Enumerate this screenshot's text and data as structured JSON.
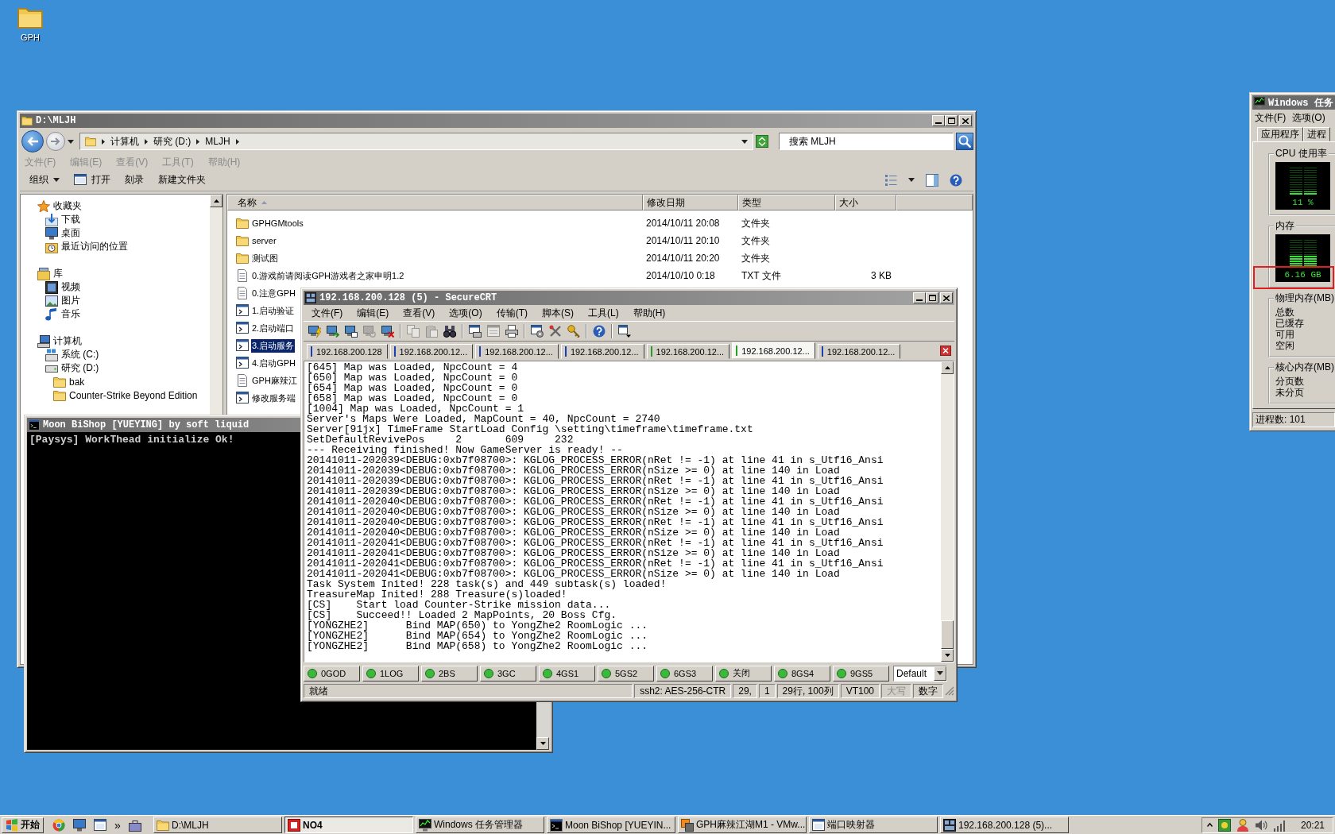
{
  "desktop": {
    "icons": [
      {
        "label": "GPH"
      }
    ]
  },
  "explorer": {
    "title": "D:\\MLJH",
    "breadcrumb": [
      "计算机",
      "研究 (D:)",
      "MLJH"
    ],
    "search": {
      "placeholder": "搜索 MLJH"
    },
    "menu": [
      "文件(F)",
      "编辑(E)",
      "查看(V)",
      "工具(T)",
      "帮助(H)"
    ],
    "toolbar": [
      {
        "label": "组织",
        "kind": "menu"
      },
      {
        "label": "打开",
        "kind": "open"
      },
      {
        "label": "刻录",
        "kind": "plain"
      },
      {
        "label": "新建文件夹",
        "kind": "plain"
      }
    ],
    "nav": [
      {
        "label": "收藏夹",
        "kind": "favorites",
        "children": [
          {
            "label": "下载",
            "kind": "download"
          },
          {
            "label": "桌面",
            "kind": "desktop"
          },
          {
            "label": "最近访问的位置",
            "kind": "recent"
          }
        ]
      },
      {
        "label": "库",
        "kind": "library",
        "children": [
          {
            "label": "视频",
            "kind": "video"
          },
          {
            "label": "图片",
            "kind": "picture"
          },
          {
            "label": "音乐",
            "kind": "music"
          }
        ]
      },
      {
        "label": "计算机",
        "kind": "computer",
        "children": [
          {
            "label": "系统 (C:)",
            "kind": "system-drive"
          },
          {
            "label": "研究 (D:)",
            "kind": "drive",
            "children": [
              {
                "label": "bak",
                "kind": "folder"
              },
              {
                "label": "Counter-Strike Beyond Edition",
                "kind": "folder"
              }
            ]
          }
        ]
      }
    ],
    "columns": [
      {
        "label": "名称",
        "sorted": true
      },
      {
        "label": "修改日期",
        "sorted": false
      },
      {
        "label": "类型",
        "sorted": false
      },
      {
        "label": "大小",
        "sorted": false
      }
    ],
    "rows": [
      {
        "name": "GPHGMtools",
        "kind": "folder",
        "date": "2014/10/11 20:08",
        "type": "文件夹",
        "selected": false
      },
      {
        "name": "server",
        "kind": "folder",
        "date": "2014/10/11 20:10",
        "type": "文件夹",
        "selected": false
      },
      {
        "name": "测试图",
        "kind": "folder",
        "date": "2014/10/11 20:20",
        "type": "文件夹",
        "selected": false
      },
      {
        "name": "0.游戏前请阅读GPH游戏者之家申明1.2",
        "kind": "document",
        "date": "2014/10/10 0:18",
        "type": "TXT 文件",
        "size": "3 KB",
        "selected": false
      },
      {
        "name": "0.注意GPH",
        "kind": "document",
        "selected": false
      },
      {
        "name": "1.启动验证",
        "kind": "program",
        "selected": false
      },
      {
        "name": "2.启动端口",
        "kind": "program",
        "selected": false
      },
      {
        "name": "3.启动服务",
        "kind": "program",
        "selected": true
      },
      {
        "name": "4.启动GPH",
        "kind": "program",
        "selected": false
      },
      {
        "name": "GPH麻辣江",
        "kind": "document",
        "selected": false
      },
      {
        "name": "修改服务端",
        "kind": "program",
        "selected": false
      }
    ]
  },
  "console": {
    "title": "Moon BiShop [YUEYING] by soft liquid",
    "lines": [
      "[Paysys] WorkThead initialize Ok!"
    ]
  },
  "securecrt": {
    "title": "192.168.200.128 (5) - SecureCRT",
    "menu": [
      "文件(F)",
      "编辑(E)",
      "查看(V)",
      "选项(O)",
      "传输(T)",
      "脚本(S)",
      "工具(L)",
      "帮助(H)"
    ],
    "toolbar": [
      {
        "items": [
          {
            "kind": "monitor-bolt",
            "disabled": false
          },
          {
            "kind": "monitor-arrow",
            "disabled": false
          },
          {
            "kind": "monitor-tab",
            "disabled": false
          },
          {
            "kind": "monitor-cycle",
            "disabled": true
          },
          {
            "kind": "monitor-cross",
            "disabled": false
          }
        ]
      },
      {
        "items": [
          {
            "kind": "copy",
            "disabled": true
          },
          {
            "kind": "paste",
            "disabled": true
          },
          {
            "kind": "binoculars",
            "disabled": false
          }
        ]
      },
      {
        "items": [
          {
            "kind": "window-printer",
            "disabled": false
          },
          {
            "kind": "window-lines",
            "disabled": true
          },
          {
            "kind": "printer",
            "disabled": false
          }
        ]
      },
      {
        "items": [
          {
            "kind": "window-gear",
            "disabled": false
          },
          {
            "kind": "tools",
            "disabled": false
          },
          {
            "kind": "key",
            "disabled": false
          }
        ]
      },
      {
        "items": [
          {
            "kind": "help",
            "disabled": false
          }
        ]
      },
      {
        "items": [
          {
            "kind": "window-caret",
            "disabled": false
          }
        ]
      }
    ],
    "tabs": [
      {
        "label": "192.168.200.128",
        "selected": false,
        "color": "#1c3fb0"
      },
      {
        "label": "192.168.200.12...",
        "selected": false,
        "color": "#1c3fb0"
      },
      {
        "label": "192.168.200.12...",
        "selected": false,
        "color": "#1c3fb0"
      },
      {
        "label": "192.168.200.12...",
        "selected": false,
        "color": "#1c3fb0"
      },
      {
        "label": "192.168.200.12...",
        "selected": false,
        "color": "#2a9a2a"
      },
      {
        "label": "192.168.200.12...",
        "selected": true,
        "color": "#2a9a2a"
      },
      {
        "label": "192.168.200.12...",
        "selected": false,
        "color": "#1c3fb0"
      }
    ],
    "lines": [
      "[645] Map was Loaded, NpcCount = 4",
      "[650] Map was Loaded, NpcCount = 0",
      "[654] Map was Loaded, NpcCount = 0",
      "[658] Map was Loaded, NpcCount = 0",
      "[1004] Map was Loaded, NpcCount = 1",
      "Server's Maps Were Loaded, MapCount = 40, NpcCount = 2740",
      "Server[91jx] TimeFrame StartLoad Config \\setting\\timeframe\\timeframe.txt",
      "SetDefaultRevivePos\t2\t609\t232",
      "--- Receiving finished! Now GameServer is ready! --",
      "20141011-202039<DEBUG:0xb7f08700>: KGLOG_PROCESS_ERROR(nRet != -1) at line 41 in s_Utf16_Ansi",
      "20141011-202039<DEBUG:0xb7f08700>: KGLOG_PROCESS_ERROR(nSize >= 0) at line 140 in Load",
      "20141011-202039<DEBUG:0xb7f08700>: KGLOG_PROCESS_ERROR(nRet != -1) at line 41 in s_Utf16_Ansi",
      "20141011-202039<DEBUG:0xb7f08700>: KGLOG_PROCESS_ERROR(nSize >= 0) at line 140 in Load",
      "20141011-202040<DEBUG:0xb7f08700>: KGLOG_PROCESS_ERROR(nRet != -1) at line 41 in s_Utf16_Ansi",
      "20141011-202040<DEBUG:0xb7f08700>: KGLOG_PROCESS_ERROR(nSize >= 0) at line 140 in Load",
      "20141011-202040<DEBUG:0xb7f08700>: KGLOG_PROCESS_ERROR(nRet != -1) at line 41 in s_Utf16_Ansi",
      "20141011-202040<DEBUG:0xb7f08700>: KGLOG_PROCESS_ERROR(nSize >= 0) at line 140 in Load",
      "20141011-202041<DEBUG:0xb7f08700>: KGLOG_PROCESS_ERROR(nRet != -1) at line 41 in s_Utf16_Ansi",
      "20141011-202041<DEBUG:0xb7f08700>: KGLOG_PROCESS_ERROR(nSize >= 0) at line 140 in Load",
      "20141011-202041<DEBUG:0xb7f08700>: KGLOG_PROCESS_ERROR(nRet != -1) at line 41 in s_Utf16_Ansi",
      "20141011-202041<DEBUG:0xb7f08700>: KGLOG_PROCESS_ERROR(nSize >= 0) at line 140 in Load",
      "Task System Inited! 228 task(s) and 449 subtask(s) loaded!",
      "TreasureMap Inited! 288 Treasure(s)loaded!",
      "[CS]\tStart load Counter-Strike mission data...",
      "[CS]\tSucceed!! Loaded 2 MapPoints, 20 Boss Cfg.",
      "[YONGZHE2]\tBind MAP(650) to YongZhe2 RoomLogic ...",
      "[YONGZHE2]\tBind MAP(654) to YongZhe2 RoomLogic ...",
      "[YONGZHE2]\tBind MAP(658) to YongZhe2 RoomLogic ..."
    ],
    "buttons": [
      "0GOD",
      "1LOG",
      "2BS",
      "3GC",
      "4GS1",
      "5GS2",
      "6GS3",
      "关闭",
      "8GS4",
      "9GS5"
    ],
    "session_select": "Default",
    "status": {
      "left": "就绪",
      "cells": [
        {
          "text": "ssh2: AES-256-CTR",
          "disabled": false
        },
        {
          "text": "29,",
          "disabled": false
        },
        {
          "text": "1",
          "disabled": false
        },
        {
          "text": "29行, 100列",
          "disabled": false
        },
        {
          "text": "VT100",
          "disabled": false
        },
        {
          "text": "大写",
          "disabled": true
        },
        {
          "text": "数字",
          "disabled": false
        }
      ]
    }
  },
  "task_manager": {
    "title": "Windows 任务",
    "menu": [
      "文件(F)",
      "选项(O)"
    ],
    "tabs": [
      {
        "label": "应用程序",
        "selected": false
      },
      {
        "label": "进程",
        "selected": false
      }
    ],
    "meters": [
      {
        "label": "CPU 使用率",
        "reading": "11 %",
        "level": 0.11,
        "highlighted": false
      },
      {
        "label": "内存",
        "reading": "6.16 GB",
        "level": 0.38,
        "highlighted": true
      }
    ],
    "groups": [
      {
        "label": "物理内存(MB)",
        "rows": [
          "总数",
          "已缓存",
          "可用",
          "空闲"
        ]
      },
      {
        "label": "核心内存(MB)",
        "rows": [
          "分页数",
          "未分页"
        ]
      }
    ],
    "status": "进程数: 101"
  },
  "taskbar": {
    "start": "开始",
    "overflow": "»",
    "tasks": [
      {
        "label": "D:\\MLJH",
        "kind": "folder",
        "selected": false
      },
      {
        "label": "NO4",
        "kind": "game",
        "selected": true
      },
      {
        "label": "Windows 任务管理器",
        "kind": "taskmgr",
        "selected": false
      },
      {
        "label": "Moon BiShop [YUEYIN...",
        "kind": "console",
        "selected": false
      },
      {
        "label": "GPH麻辣江湖M1 - VMw...",
        "kind": "vm",
        "selected": false
      },
      {
        "label": "端口映射器",
        "kind": "app",
        "selected": false
      },
      {
        "label": "192.168.200.128 (5)...",
        "kind": "terminal",
        "selected": false
      }
    ],
    "clock": "20:21"
  }
}
